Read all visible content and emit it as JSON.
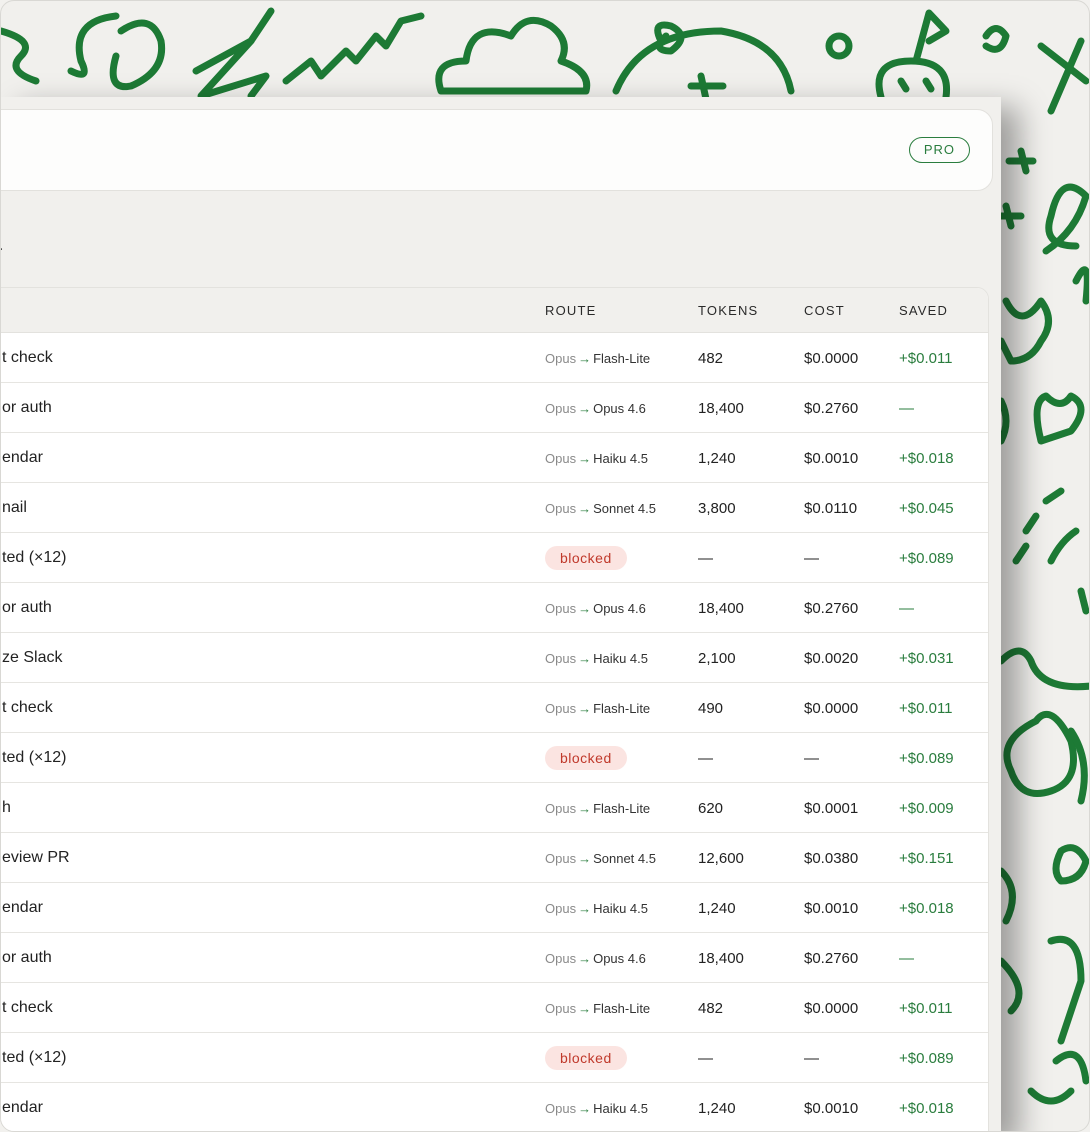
{
  "header": {
    "badge": "PRO"
  },
  "page": {
    "title_fragment": "d"
  },
  "table": {
    "columns": {
      "route": "ROUTE",
      "tokens": "TOKENS",
      "cost": "COST",
      "saved": "SAVED"
    },
    "rows": [
      {
        "task": "t check",
        "from": "Opus",
        "to": "Flash-Lite",
        "tokens": "482",
        "cost": "$0.0000",
        "saved": "+$0.011"
      },
      {
        "task": "or auth",
        "from": "Opus",
        "to": "Opus 4.6",
        "tokens": "18,400",
        "cost": "$0.2760",
        "saved": "—"
      },
      {
        "task": "endar",
        "from": "Opus",
        "to": "Haiku 4.5",
        "tokens": "1,240",
        "cost": "$0.0010",
        "saved": "+$0.018"
      },
      {
        "task": "nail",
        "from": "Opus",
        "to": "Sonnet 4.5",
        "tokens": "3,800",
        "cost": "$0.0110",
        "saved": "+$0.045"
      },
      {
        "task": "ted (×12)",
        "blocked": "blocked",
        "tokens": "—",
        "cost": "—",
        "saved": "+$0.089"
      },
      {
        "task": "or auth",
        "from": "Opus",
        "to": "Opus 4.6",
        "tokens": "18,400",
        "cost": "$0.2760",
        "saved": "—"
      },
      {
        "task": "ze Slack",
        "from": "Opus",
        "to": "Haiku 4.5",
        "tokens": "2,100",
        "cost": "$0.0020",
        "saved": "+$0.031"
      },
      {
        "task": "t check",
        "from": "Opus",
        "to": "Flash-Lite",
        "tokens": "490",
        "cost": "$0.0000",
        "saved": "+$0.011"
      },
      {
        "task": "ted (×12)",
        "blocked": "blocked",
        "tokens": "—",
        "cost": "—",
        "saved": "+$0.089"
      },
      {
        "task": "h",
        "from": "Opus",
        "to": "Flash-Lite",
        "tokens": "620",
        "cost": "$0.0001",
        "saved": "+$0.009"
      },
      {
        "task": "eview PR",
        "from": "Opus",
        "to": "Sonnet 4.5",
        "tokens": "12,600",
        "cost": "$0.0380",
        "saved": "+$0.151"
      },
      {
        "task": "endar",
        "from": "Opus",
        "to": "Haiku 4.5",
        "tokens": "1,240",
        "cost": "$0.0010",
        "saved": "+$0.018"
      },
      {
        "task": "or auth",
        "from": "Opus",
        "to": "Opus 4.6",
        "tokens": "18,400",
        "cost": "$0.2760",
        "saved": "—"
      },
      {
        "task": "t check",
        "from": "Opus",
        "to": "Flash-Lite",
        "tokens": "482",
        "cost": "$0.0000",
        "saved": "+$0.011"
      },
      {
        "task": "ted (×12)",
        "blocked": "blocked",
        "tokens": "—",
        "cost": "—",
        "saved": "+$0.089"
      },
      {
        "task": "endar",
        "from": "Opus",
        "to": "Haiku 4.5",
        "tokens": "1,240",
        "cost": "$0.0010",
        "saved": "+$0.018"
      }
    ]
  },
  "colors": {
    "accent": "#1d7a35",
    "blocked_bg": "#fbe4e1",
    "blocked_text": "#c0392b"
  }
}
